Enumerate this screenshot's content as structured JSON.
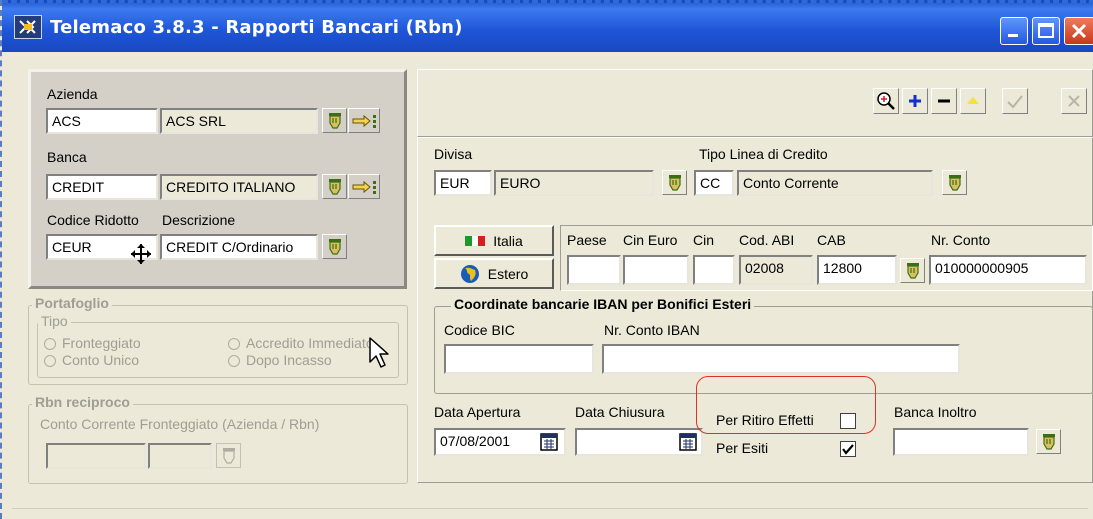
{
  "window": {
    "title": "Telemaco 3.8.3  - Rapporti Bancari (Rbn)",
    "controls": [
      "minimize-icon",
      "maximize-icon",
      "close-icon"
    ]
  },
  "toolbar": {
    "buttons": [
      {
        "name": "zoom-search",
        "icon": "zoom-in-icon"
      },
      {
        "name": "add",
        "icon": "plus-icon"
      },
      {
        "name": "remove",
        "icon": "minus-icon"
      },
      {
        "name": "move-up",
        "icon": "triangle-up-icon"
      },
      {
        "name": "confirm",
        "icon": "checkmark-icon"
      },
      {
        "name": "cancel",
        "icon": "x-icon"
      }
    ]
  },
  "azienda": {
    "label": "Azienda",
    "code": "ACS",
    "name": "ACS SRL"
  },
  "banca": {
    "label": "Banca",
    "code": "CREDIT",
    "name": "CREDITO ITALIANO"
  },
  "codice": {
    "label_code": "Codice Ridotto",
    "label_desc": "Descrizione",
    "code": "CEUR",
    "desc": "CREDIT C/Ordinario"
  },
  "portafoglio": {
    "title": "Portafoglio",
    "tipo_title": "Tipo",
    "options": [
      "Fronteggiato",
      "Conto Unico",
      "Accredito Immediato",
      "Dopo Incasso"
    ]
  },
  "rbn_reciproco": {
    "title": "Rbn reciproco",
    "label": "Conto Corrente Fronteggiato (Azienda / Rbn)",
    "field1": "",
    "field2": ""
  },
  "divisa": {
    "label": "Divisa",
    "code": "EUR",
    "name": "EURO"
  },
  "linea": {
    "label": "Tipo Linea di Credito",
    "code": "CC",
    "name": "Conto Corrente"
  },
  "country_buttons": {
    "italia": "Italia",
    "estero": "Estero"
  },
  "bank_coords": {
    "labels": {
      "paese": "Paese",
      "cin_euro": "Cin Euro",
      "cin": "Cin",
      "abi": "Cod. ABI",
      "cab": "CAB",
      "conto": "Nr. Conto"
    },
    "values": {
      "paese": "",
      "cin_euro": "",
      "cin": "",
      "abi": "02008",
      "cab": "12800",
      "conto": "010000000905"
    }
  },
  "iban": {
    "title": "Coordinate bancarie IBAN per Bonifici Esteri",
    "bic_label": "Codice BIC",
    "iban_label": "Nr. Conto IBAN",
    "bic": "",
    "iban": ""
  },
  "dates": {
    "apertura_label": "Data Apertura",
    "apertura": "07/08/2001",
    "chiusura_label": "Data Chiusura",
    "chiusura": ""
  },
  "checks": {
    "ritiro_label": "Per Ritiro Effetti",
    "ritiro_checked": false,
    "esiti_label": "Per Esiti",
    "esiti_checked": true
  },
  "banca_inoltro": {
    "label": "Banca Inoltro",
    "value": ""
  },
  "colors": {
    "titlebar": "#1f56d8",
    "window_bg": "#ece9d8",
    "panel_bg": "#d4d0c8",
    "annotation": "#e0302c",
    "lookup_icon": "#3c6e14"
  }
}
